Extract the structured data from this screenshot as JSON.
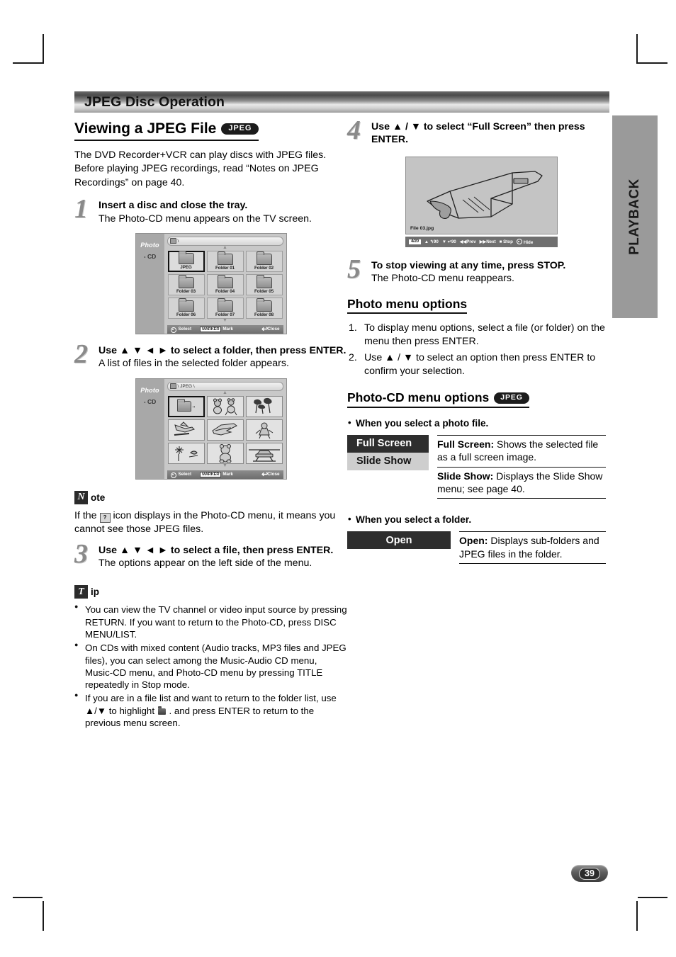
{
  "page": {
    "banner_title": "JPEG Disc Operation",
    "side_tab": "PLAYBACK",
    "page_number": "39"
  },
  "left_column": {
    "heading": "Viewing a JPEG File",
    "heading_badge": "JPEG",
    "intro": "The DVD Recorder+VCR can play discs with JPEG files. Before playing JPEG recordings, read “Notes on JPEG Recordings” on page 40.",
    "steps": [
      {
        "number": "1",
        "title": "Insert a disc and close the tray.",
        "desc": "The Photo-CD menu appears on the TV screen."
      },
      {
        "number": "2",
        "title": "Use ▲ ▼ ◄ ► to select a folder, then press ENTER.",
        "desc": "A list of files in the selected folder appears."
      },
      {
        "number": "3",
        "title": "Use ▲ ▼ ◄ ► to select a file, then press ENTER.",
        "desc": "The options appear on the left side of the menu."
      }
    ],
    "folder_screen": {
      "sidebar_title": "Photo",
      "sidebar_sub": "- CD",
      "path": "\\",
      "cells": [
        "JPEG",
        "Folder 01",
        "Folder 02",
        "Folder 03",
        "Folder 04",
        "Folder 05",
        "Folder 06",
        "Folder 07",
        "Folder 08"
      ],
      "selected_index": 0,
      "status_select": "Select",
      "status_marker_key": "MARKER",
      "status_mark": "Mark",
      "status_close": "Close"
    },
    "file_screen": {
      "sidebar_title": "Photo",
      "sidebar_sub": "- CD",
      "path": "\\ JPEG \\",
      "thumbs": [
        "up-folder",
        "teddy-bears",
        "trees",
        "airplane-small",
        "space-shuttle",
        "clown",
        "fireworks",
        "teddy-bear-sitting",
        "car"
      ],
      "selected_index": 0,
      "status_select": "Select",
      "status_marker_key": "MARKER",
      "status_mark": "Mark",
      "status_close": "Close"
    },
    "note": {
      "glyph": "N",
      "word": "ote",
      "text_before": "If the",
      "icon": "?",
      "text_after": "icon displays in the Photo-CD menu, it means you cannot see those JPEG files."
    },
    "tip": {
      "glyph": "T",
      "word": "ip",
      "items": [
        "You can view the TV channel or video input source by pressing RETURN. If you want to return to the Photo-CD, press DISC MENU/LIST.",
        "On CDs with mixed content (Audio tracks, MP3 files and JPEG files), you can select among the Music-Audio CD menu, Music-CD menu, and Photo-CD menu by pressing TITLE repeatedly in Stop mode.",
        "If you are in a file list and want to return to the folder list, use ▲/▼ to highlight  . and press ENTER to return to the previous menu screen."
      ],
      "item3_before": "If you are in a file list and want to return to the folder list, use ▲/▼ to highlight",
      "item3_after": ". and press ENTER to return to the previous menu screen."
    }
  },
  "right_column": {
    "steps": [
      {
        "number": "4",
        "title": "Use ▲ / ▼ to select “Full Screen” then press ENTER.",
        "desc": ""
      },
      {
        "number": "5",
        "title": "To stop viewing at any time, press STOP.",
        "desc": "The Photo-CD menu reappears."
      }
    ],
    "fullscreen_figure": {
      "file_name": "File 03.jpg",
      "count": "4/20",
      "rotate_up": "90",
      "rotate_down": "90",
      "prev": "Prev",
      "next": "Next",
      "stop": "Stop",
      "hide": "Hide"
    },
    "photo_menu_options": {
      "heading": "Photo menu options",
      "items": [
        "To display menu options, select a file (or folder) on the menu then press ENTER.",
        "Use ▲ / ▼ to select an option then press ENTER to confirm your selection."
      ]
    },
    "photocd_menu_options": {
      "heading": "Photo-CD menu options",
      "heading_badge": "JPEG",
      "photo_file_label": "When you select a photo file.",
      "photo_file_menu": [
        {
          "label": "Full Screen",
          "highlighted": true
        },
        {
          "label": "Slide Show",
          "highlighted": false
        }
      ],
      "photo_file_desc": [
        {
          "term": "Full Screen:",
          "text": " Shows the selected file as a full screen image."
        },
        {
          "term": "Slide Show:",
          "text": " Displays the Slide Show menu; see page 40."
        }
      ],
      "folder_label": "When you select a folder.",
      "folder_menu": [
        {
          "label": "Open",
          "highlighted": true
        }
      ],
      "folder_desc": [
        {
          "term": "Open:",
          "text": " Displays sub-folders and JPEG files in the folder."
        }
      ]
    }
  }
}
